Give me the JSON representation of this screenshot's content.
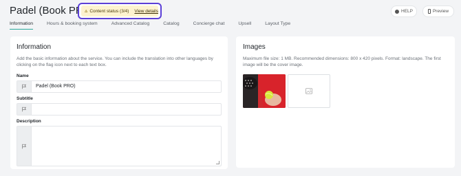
{
  "header": {
    "title": "Padel (Book PRO)",
    "content_status": "Content status (3/4)",
    "view_details": "View details",
    "help_label": "HELP",
    "preview_label": "Preview"
  },
  "tabs": [
    {
      "label": "Information"
    },
    {
      "label": "Hours & booking system"
    },
    {
      "label": "Advanced Catalog"
    },
    {
      "label": "Catalog"
    },
    {
      "label": "Concierge chat"
    },
    {
      "label": "Upsell"
    },
    {
      "label": "Layout Type"
    }
  ],
  "information": {
    "title": "Information",
    "description": "Add the basic information about the service. You can include the translation into other languages by clicking on the flag icon next to each text box.",
    "name_label": "Name",
    "name_value": "Padel (Book PRO)",
    "subtitle_label": "Subtitle",
    "subtitle_value": "",
    "description_label": "Description",
    "description_value": ""
  },
  "images": {
    "title": "Images",
    "description": "Maximum file size: 1 MB. Recommended dimensions: 800 x 420 pixels. Format: landscape. The first image will be the cover image."
  },
  "colors": {
    "accent": "#2aa89a",
    "status_border": "#5b3fd6",
    "status_bg": "#fdf3cf"
  }
}
